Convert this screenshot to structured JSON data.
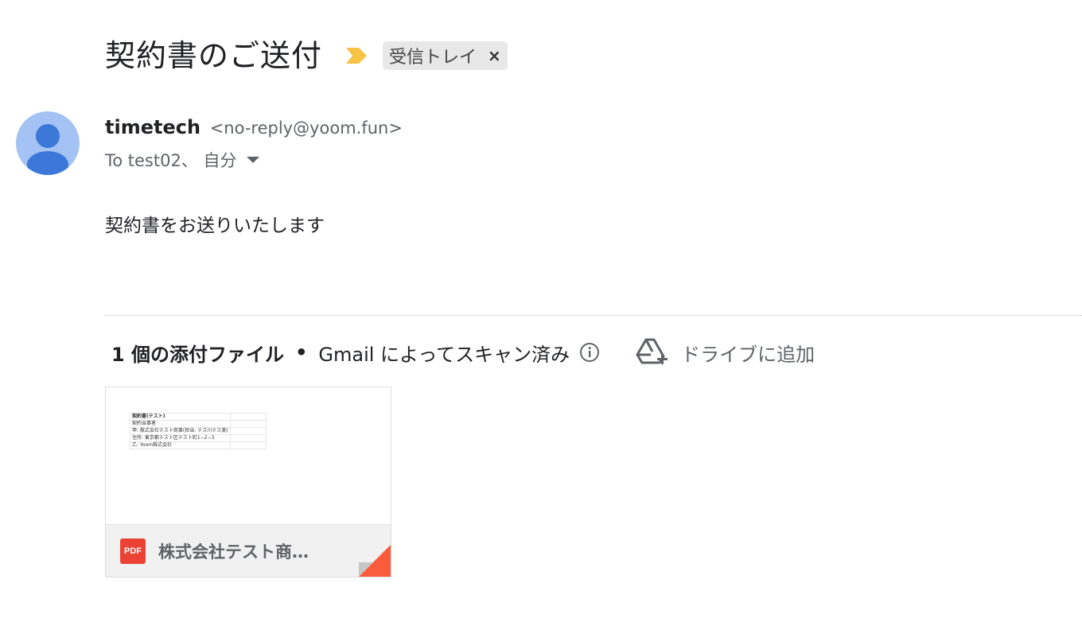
{
  "email": {
    "subject": "契約書のご送付",
    "label": "受信トレイ",
    "label_close": "×",
    "sender_name": "timetech",
    "sender_email": "<no-reply@yoom.fun>",
    "to_line": "To test02、 自分",
    "body": "契約書をお送りいたします"
  },
  "attachments": {
    "count_label": "1 個の添付ファイル",
    "separator": "•",
    "scan_label": "Gmail によってスキャン済み",
    "drive_label": "ドライブに追加",
    "file_type": "PDF",
    "file_name": "株式会社テスト商…",
    "preview_rows": [
      [
        "契約書(テスト)",
        ""
      ],
      [
        "契約当事者",
        ""
      ],
      [
        "甲: 株式会社テスト商事(担当: テス川テス美)",
        ""
      ],
      [
        "住所: 東京都テスト区テスト町1−2−3",
        ""
      ],
      [
        "乙: Yoom株式会社",
        ""
      ]
    ]
  },
  "colors": {
    "importance": "#f6c344",
    "avatar_bg": "#a4c2f4",
    "avatar_fg": "#3c78d8",
    "pdf": "#ea4335",
    "corner_fold": "#fa5b3a"
  },
  "icons": [
    "importance-marker-icon",
    "close-icon",
    "avatar-person-icon",
    "dropdown-caret-icon",
    "info-icon",
    "drive-add-icon",
    "pdf-icon"
  ]
}
